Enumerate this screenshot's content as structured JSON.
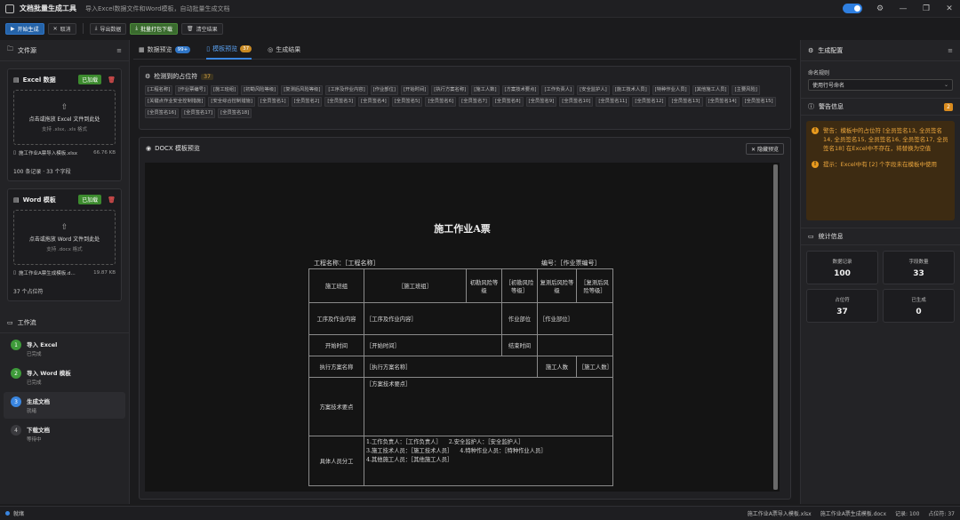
{
  "window": {
    "title": "文档批量生成工具",
    "subtitle": "导入Excel数据文件和Word模板，自动批量生成文档"
  },
  "toolbar": {
    "start": "开始生成",
    "cancel": "取消",
    "export_data": "导出数据",
    "batch_download": "批量打包下载",
    "clear_results": "清空结果"
  },
  "left": {
    "title": "文件源",
    "excel": {
      "title": "Excel 数据",
      "status": "已加载",
      "drop_main": "点击或拖放 Excel 文件到此处",
      "drop_sub": "支持 .xlsx, .xls 格式",
      "file_name": "施工作业A票导入模板.xlsx",
      "file_size": "66.76 KB",
      "footer": "100 条记录 · 33 个字段"
    },
    "word": {
      "title": "Word 模板",
      "status": "已加载",
      "drop_main": "点击或拖放 Word 文件到此处",
      "drop_sub": "支持 .docx 格式",
      "file_name": "施工作业A票生成模板.d...",
      "file_size": "19.87 KB",
      "footer": "37 个占位符"
    },
    "workflow_title": "工作流",
    "steps": [
      {
        "n": "1",
        "title": "导入 Excel",
        "sub": "已完成"
      },
      {
        "n": "2",
        "title": "导入 Word 模板",
        "sub": "已完成"
      },
      {
        "n": "3",
        "title": "生成文档",
        "sub": "就绪"
      },
      {
        "n": "4",
        "title": "下载文档",
        "sub": "等待中"
      }
    ]
  },
  "tabs": {
    "data_preview": "数据预览",
    "data_badge": "99+",
    "template_preview": "模板预览",
    "template_badge": "37",
    "results": "生成结果"
  },
  "placeholders": {
    "title": "检测到的占位符",
    "count": "37",
    "tags": [
      "[工程名称]",
      "[作业票编号]",
      "[施工班组]",
      "[初勘风险等级]",
      "[复测后风险等级]",
      "[工序及作业内容]",
      "[作业部位]",
      "[开始时间]",
      "[执行方案名称]",
      "[施工人数]",
      "[方案技术要点]",
      "[工作负责人]",
      "[安全监护人]",
      "[施工技术人员]",
      "[特种作业人员]",
      "[其他施工人员]",
      "[主要风险]",
      "[关键点作业安全控制措施]",
      "[安全综合控制措施]",
      "[全员签名1]",
      "[全员签名2]",
      "[全员签名3]",
      "[全员签名4]",
      "[全员签名5]",
      "[全员签名6]",
      "[全员签名7]",
      "[全员签名8]",
      "[全员签名9]",
      "[全员签名10]",
      "[全员签名11]",
      "[全员签名12]",
      "[全员签名13]",
      "[全员签名14]",
      "[全员签名15]",
      "[全员签名16]",
      "[全员签名17]",
      "[全员签名18]"
    ]
  },
  "docx": {
    "title": "DOCX 模板预览",
    "hide": "隐藏预览",
    "doc_title": "施工作业A票",
    "project": "工程名称：［工程名称］",
    "number": "编号：［作业票编号］",
    "r1": [
      "施工班组",
      "［施工班组］",
      "初勘风险等级",
      "［初勘风险等级］",
      "复测后风险等级",
      "［复测后风险等级］"
    ],
    "r2": [
      "工序及作业内容",
      "［工序及作业内容］",
      "作业部位",
      "［作业部位］"
    ],
    "r3": [
      "开始时间",
      "［开始时间］",
      "结束时间",
      ""
    ],
    "r4": [
      "执行方案名称",
      "［执行方案名称］",
      "施工人数",
      "［施工人数］"
    ],
    "r5": [
      "方案技术要点",
      "［方案技术要点］"
    ],
    "r6": [
      "具体人员分工",
      "1.工作负责人：［工作负责人］",
      "2.安全监护人：［安全监护人］",
      "3.施工技术人员：［施工技术人员］",
      "4.特种作业人员：［特种作业人员］",
      "4.其他施工人员：［其他施工人员］"
    ]
  },
  "right": {
    "title": "生成配置",
    "naming_label": "命名规则",
    "naming_value": "使用行号命名",
    "warn_title": "警告信息",
    "warn_count": "2",
    "warn1": "警告：模板中的占位符 [全员签名13, 全员签名14, 全员签名15, 全员签名16, 全员签名17, 全员签名18] 在Excel中不存在，将替换为空值",
    "warn2": "提示：Excel中有 [2] 个字段未在模板中使用",
    "stats_title": "统计信息",
    "stats": [
      {
        "label": "数据记录",
        "value": "100"
      },
      {
        "label": "字段数量",
        "value": "33"
      },
      {
        "label": "占位符",
        "value": "37"
      },
      {
        "label": "已生成",
        "value": "0"
      }
    ]
  },
  "status": {
    "left": "就绪",
    "file1": "施工作业A票导入模板.xlsx",
    "file2": "施工作业A票生成模板.docx",
    "records": "记录: 100",
    "placeholders": "占位符: 37"
  },
  "colors": {
    "accent": "#3a86e0",
    "success": "#3c8a2e",
    "warning": "#e89a1e"
  }
}
